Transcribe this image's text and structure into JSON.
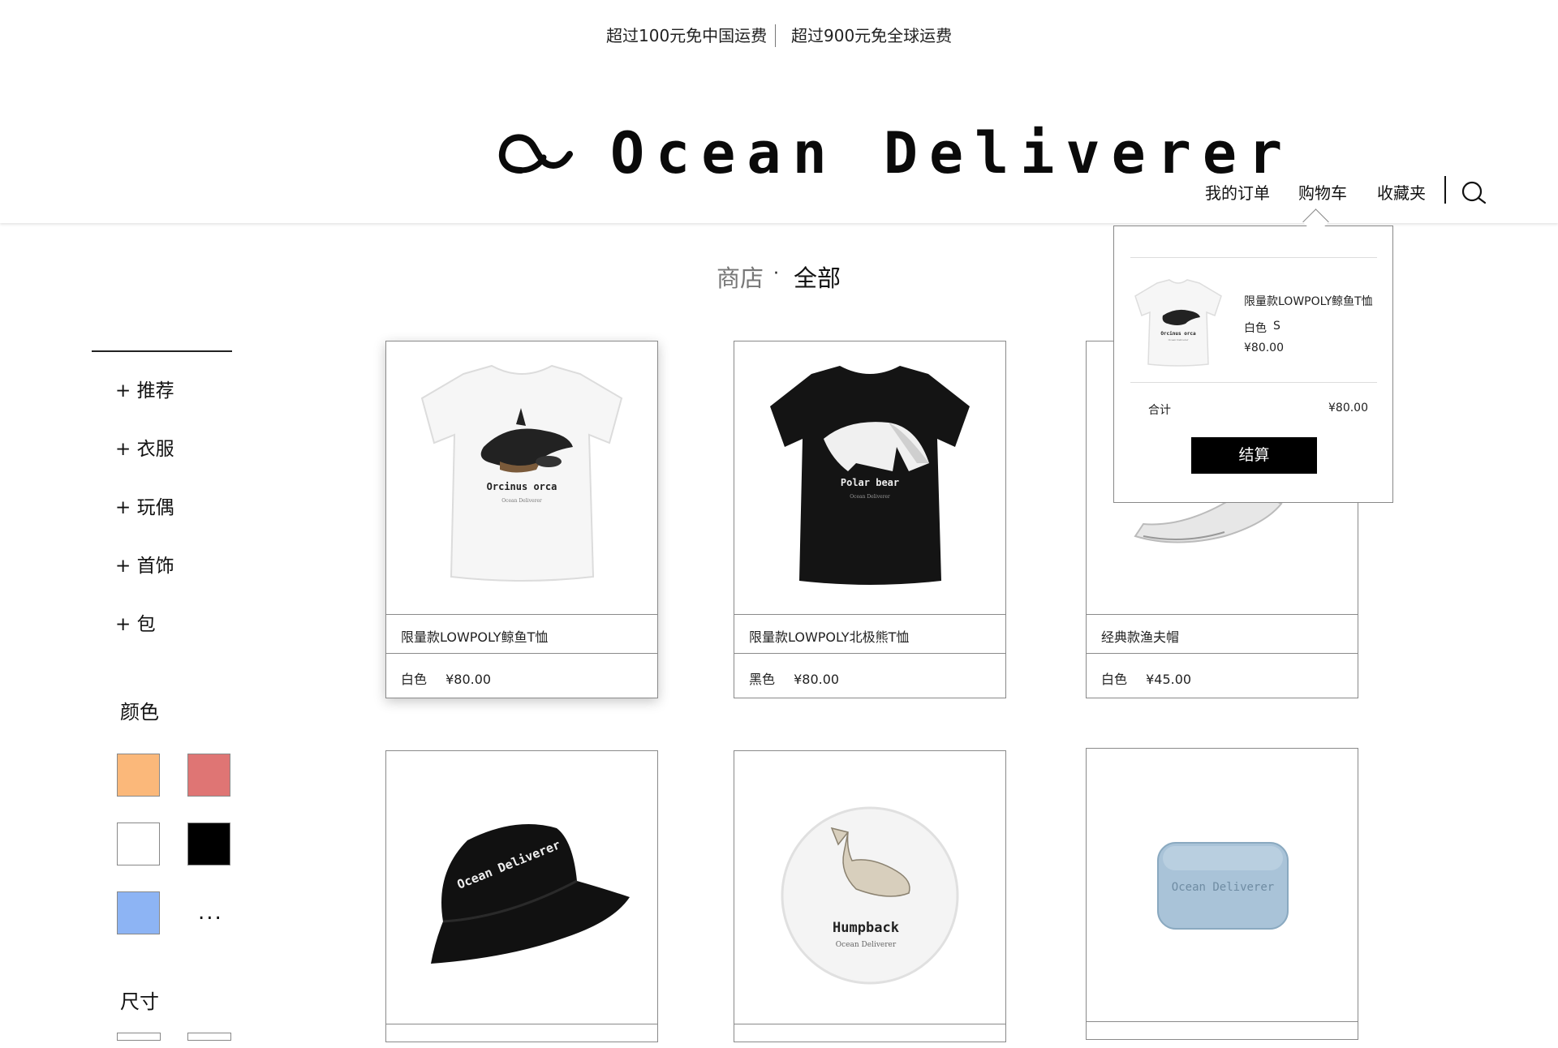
{
  "shipping": {
    "domestic": "超过100元免中国运费",
    "global": "超过900元免全球运费"
  },
  "brand": {
    "name": "Ocean Deliverer"
  },
  "nav": {
    "orders": "我的订单",
    "cart": "购物车",
    "favorites": "收藏夹"
  },
  "breadcrumb": {
    "shop": "商店",
    "separator": "·",
    "current": "全部"
  },
  "sidebar": {
    "categories": [
      "+ 推荐",
      "+ 衣服",
      "+ 玩偶",
      "+ 首饰",
      "+ 包"
    ],
    "color_heading": "颜色",
    "colors": [
      "#FBB87A",
      "#DF7574",
      "#FFFFFF",
      "#000000",
      "#8DB4F4"
    ],
    "more_label": "...",
    "size_heading": "尺寸"
  },
  "products": [
    {
      "name": "限量款LOWPOLY鲸鱼T恤",
      "color": "白色",
      "price": "¥80.00",
      "print_title": "Orcinus orca",
      "print_sub": "Ocean Deliverer"
    },
    {
      "name": "限量款LOWPOLY北极熊T恤",
      "color": "黑色",
      "price": "¥80.00",
      "print_title": "Polar bear",
      "print_sub": "Ocean Deliverer"
    },
    {
      "name": "经典款渔夫帽",
      "color": "白色",
      "price": "¥45.00"
    },
    {
      "print_title": "Ocean Deliverer"
    },
    {
      "print_title": "Humpback",
      "print_sub": "Ocean Deliverer"
    },
    {
      "print_title": "Ocean Deliverer"
    }
  ],
  "cart_popup": {
    "item_name": "限量款LOWPOLY鲸鱼T恤",
    "item_color": "白色",
    "item_size": "S",
    "item_price": "¥80.00",
    "total_label": "合计",
    "total_value": "¥80.00",
    "checkout_label": "结算",
    "thumb_title": "Orcinus orca",
    "thumb_sub": "Ocean Deliverer"
  }
}
